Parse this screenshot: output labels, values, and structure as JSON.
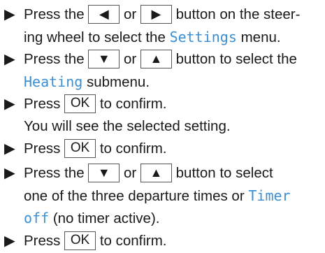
{
  "bullet": "▶",
  "display_text_color": "#3b8fd4",
  "keys": {
    "left": "◀",
    "right": "▶",
    "down": "▼",
    "up": "▲",
    "ok": "OK"
  },
  "steps": [
    {
      "l1_a": "Press the",
      "l1_b": "or",
      "l1_c": "button on the steer-",
      "l2_a": "ing wheel to select the",
      "l2_disp": "Settings",
      "l2_b": "menu."
    },
    {
      "l1_a": "Press the",
      "l1_b": "or",
      "l1_c": "button to select the",
      "l2_disp": "Heating",
      "l2_b": "submenu."
    },
    {
      "l1_a": "Press",
      "l1_b": "to confirm.",
      "l2": "You will see the selected setting."
    },
    {
      "l1_a": "Press",
      "l1_b": "to confirm."
    },
    {
      "l1_a": "Press the",
      "l1_b": "or",
      "l1_c": "button to select",
      "l2_a": "one of the three departure times or",
      "l2_disp": "Timer",
      "l3_disp": "off",
      "l3_b": "(no timer active)."
    },
    {
      "l1_a": "Press",
      "l1_b": "to confirm."
    }
  ]
}
